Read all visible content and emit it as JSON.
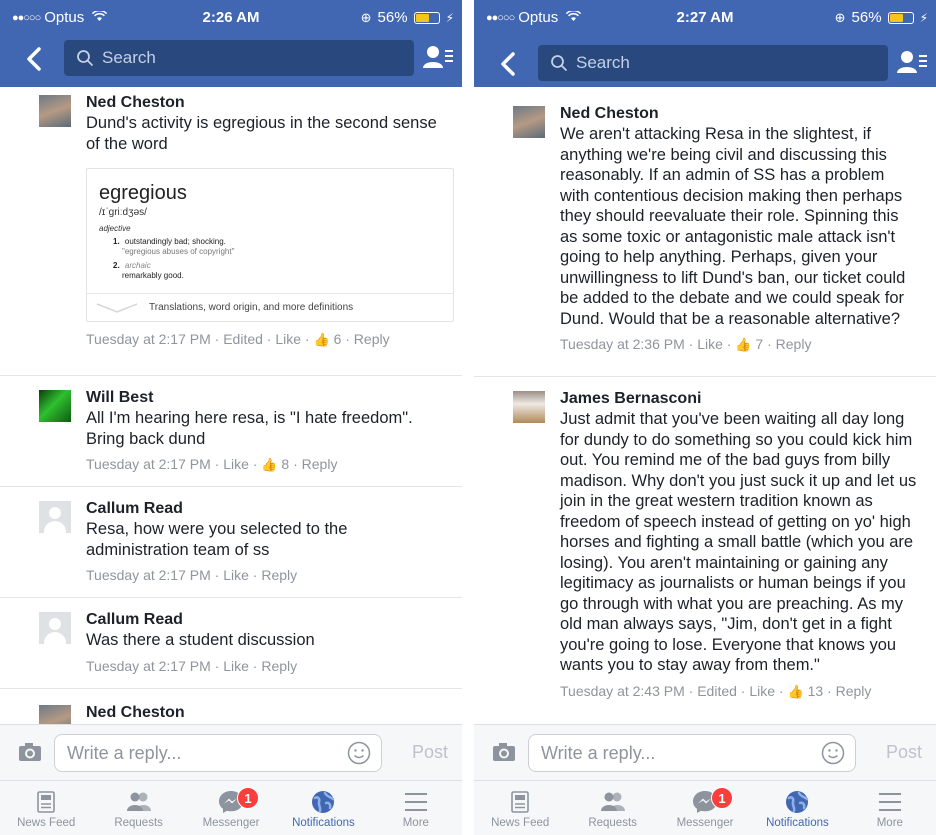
{
  "left_screen": {
    "status": {
      "dots": "●●○○○",
      "carrier": "Optus",
      "time": "2:26 AM",
      "battery": "56%"
    },
    "search": {
      "placeholder": "Search"
    },
    "comments": [
      {
        "name": "Ned Cheston",
        "text": "Dund's activity is egregious in the second sense of the word",
        "meta": "Tuesday at 2:17 PM · Edited · Like · ",
        "likes": "6",
        "reply": " · Reply"
      },
      {
        "name": "Will Best",
        "text": "All I'm hearing here resa, is \"I hate freedom\". Bring back dund",
        "meta": "Tuesday at 2:17 PM · Like · ",
        "likes": "8",
        "reply": " · Reply"
      },
      {
        "name": "Callum Read",
        "text": "Resa, how were you selected to the administration team of ss",
        "meta": "Tuesday at 2:17 PM · Like · Reply"
      },
      {
        "name": "Callum Read",
        "text": "Was there a student discussion",
        "meta": "Tuesday at 2:17 PM · Like · Reply"
      },
      {
        "name": "Ned Cheston"
      }
    ],
    "dictionary": {
      "word": "egregious",
      "pronunciation": "/ɪˈɡriːdʒəs/",
      "part_of_speech": "adjective",
      "def1_num": "1.",
      "def1": "outstandingly bad; shocking.",
      "def1_example": "\"egregious abuses of copyright\"",
      "def2_num": "2.",
      "def2_label": "archaic",
      "def2": "remarkably good.",
      "more": "Translations, word origin, and more definitions"
    },
    "reply": {
      "placeholder": "Write a reply...",
      "post": "Post"
    },
    "tabs": [
      {
        "label": "News Feed",
        "icon": "news-feed-icon"
      },
      {
        "label": "Requests",
        "icon": "requests-icon"
      },
      {
        "label": "Messenger",
        "icon": "messenger-icon",
        "badge": "1"
      },
      {
        "label": "Notifications",
        "icon": "notifications-globe-icon",
        "active": true
      },
      {
        "label": "More",
        "icon": "more-icon"
      }
    ]
  },
  "right_screen": {
    "status": {
      "dots": "●●○○○",
      "carrier": "Optus",
      "time": "2:27 AM",
      "battery": "56%"
    },
    "search": {
      "placeholder": "Search"
    },
    "comments": [
      {
        "name": "Ned Cheston",
        "text": "We aren't attacking Resa in the slightest, if anything we're being civil and discussing this reasonably. If an admin of SS has a problem with contentious decision making then perhaps they should reevaluate their role. Spinning this as some toxic or antagonistic male attack isn't going to help anything. Perhaps, given your unwillingness to lift Dund's ban, our ticket could be added to the debate and we could speak for Dund. Would that be a reasonable alternative?",
        "meta": "Tuesday at 2:36 PM · Like · ",
        "likes": "7",
        "reply": " · Reply"
      },
      {
        "name": "James Bernasconi",
        "text": "Just admit that you've been waiting all day long for dundy to do something so you could kick him out. You remind me of the bad guys from billy madison. Why don't you just suck it up and let us join in the great western tradition known as freedom of speech instead of getting on yo' high horses and fighting a small battle (which you are losing). You aren't maintaining or gaining any legitimacy as journalists or human beings if you go through with what you are preaching. As my old man always says, \"Jim, don't get in a fight you're going to lose. Everyone that knows you wants you to stay away from them.\"",
        "meta": "Tuesday at 2:43 PM · Edited · Like · ",
        "likes": "13",
        "reply": " · Reply"
      }
    ],
    "reply": {
      "placeholder": "Write a reply...",
      "post": "Post"
    },
    "tabs": [
      {
        "label": "News Feed",
        "icon": "news-feed-icon"
      },
      {
        "label": "Requests",
        "icon": "requests-icon"
      },
      {
        "label": "Messenger",
        "icon": "messenger-icon",
        "badge": "1"
      },
      {
        "label": "Notifications",
        "icon": "notifications-globe-icon",
        "active": true
      },
      {
        "label": "More",
        "icon": "more-icon"
      }
    ]
  },
  "colors": {
    "brand_blue": "#4267b2",
    "search_bg": "#29487d",
    "meta_gray": "#90949c",
    "badge_red": "#fa3e3e"
  }
}
